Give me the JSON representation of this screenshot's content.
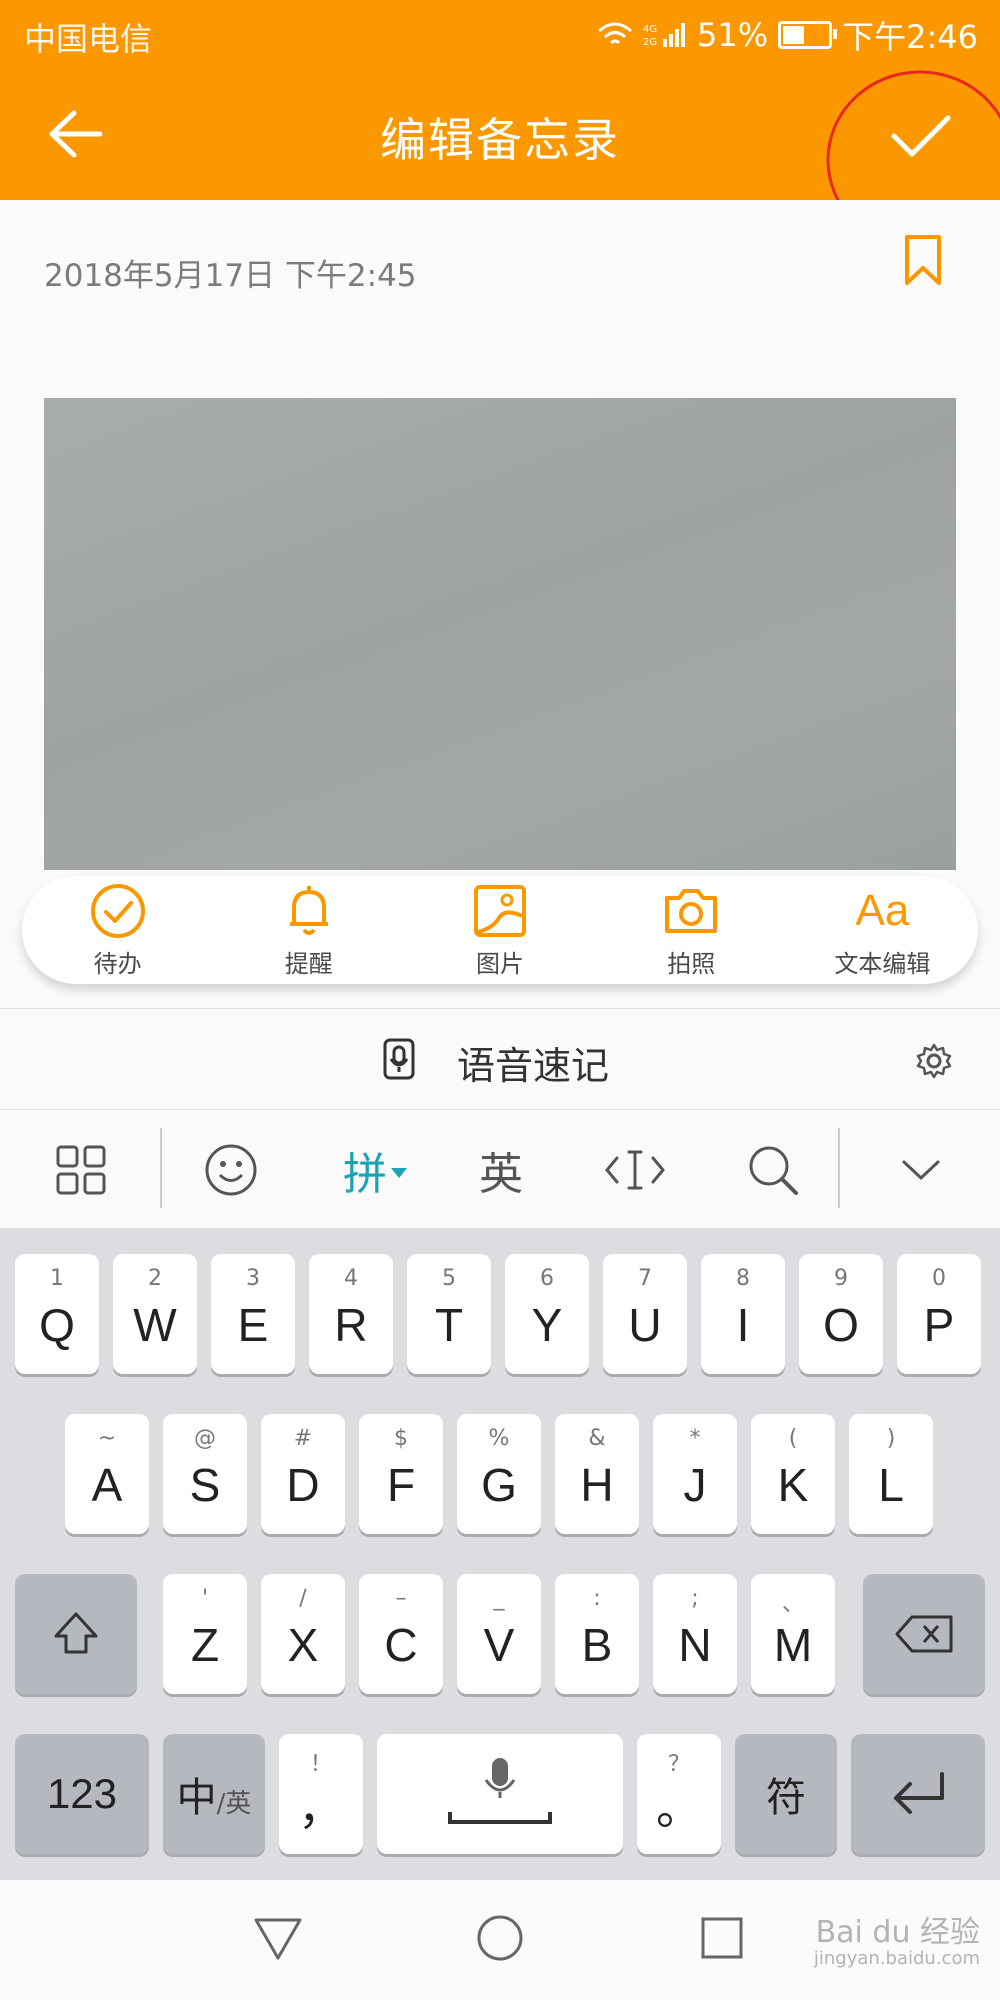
{
  "status": {
    "carrier": "中国电信",
    "network": "4G 2G",
    "battery": "51%",
    "battery_level": 0.51,
    "time": "下午2:46"
  },
  "header": {
    "title": "编辑备忘录",
    "back_icon": "arrow-left-icon",
    "confirm_icon": "checkmark-icon"
  },
  "note": {
    "timestamp": "2018年5月17日 下午2:45",
    "bookmark_icon": "bookmark-icon",
    "image": "gray-photo"
  },
  "toolbar": {
    "items": [
      {
        "label": "待办",
        "icon": "check-circle-icon"
      },
      {
        "label": "提醒",
        "icon": "bell-icon"
      },
      {
        "label": "图片",
        "icon": "image-icon"
      },
      {
        "label": "拍照",
        "icon": "camera-icon"
      },
      {
        "label": "文本编辑",
        "icon": "text-format-icon",
        "glyph": "Aa"
      }
    ]
  },
  "voice": {
    "label": "语音速记",
    "icon": "voice-recorder-icon",
    "settings_icon": "gear-icon"
  },
  "ime_bar": {
    "pinyin": "拼",
    "english": "英"
  },
  "keyboard": {
    "row1": [
      {
        "k": "Q",
        "h": "1"
      },
      {
        "k": "W",
        "h": "2"
      },
      {
        "k": "E",
        "h": "3"
      },
      {
        "k": "R",
        "h": "4"
      },
      {
        "k": "T",
        "h": "5"
      },
      {
        "k": "Y",
        "h": "6"
      },
      {
        "k": "U",
        "h": "7"
      },
      {
        "k": "I",
        "h": "8"
      },
      {
        "k": "O",
        "h": "9"
      },
      {
        "k": "P",
        "h": "0"
      }
    ],
    "row2": [
      {
        "k": "A",
        "h": "~"
      },
      {
        "k": "S",
        "h": "@"
      },
      {
        "k": "D",
        "h": "#"
      },
      {
        "k": "F",
        "h": "$"
      },
      {
        "k": "G",
        "h": "%"
      },
      {
        "k": "H",
        "h": "&"
      },
      {
        "k": "J",
        "h": "*"
      },
      {
        "k": "K",
        "h": "("
      },
      {
        "k": "L",
        "h": ")"
      }
    ],
    "row3": [
      {
        "k": "Z",
        "h": "'"
      },
      {
        "k": "X",
        "h": "/"
      },
      {
        "k": "C",
        "h": "–"
      },
      {
        "k": "V",
        "h": "_"
      },
      {
        "k": "B",
        "h": ":"
      },
      {
        "k": "N",
        "h": ";"
      },
      {
        "k": "M",
        "h": "、"
      }
    ],
    "num_key": "123",
    "lang_key_main": "中",
    "lang_key_sub": "/英",
    "comma_key": "，",
    "comma_hint": "！",
    "period_key": "。",
    "period_hint": "？",
    "symbol_key": "符"
  },
  "watermark": {
    "brand": "Bai du 经验",
    "url": "jingyan.baidu.com"
  },
  "colors": {
    "accent": "#fb9800",
    "ime_active": "#1aa3b5"
  }
}
